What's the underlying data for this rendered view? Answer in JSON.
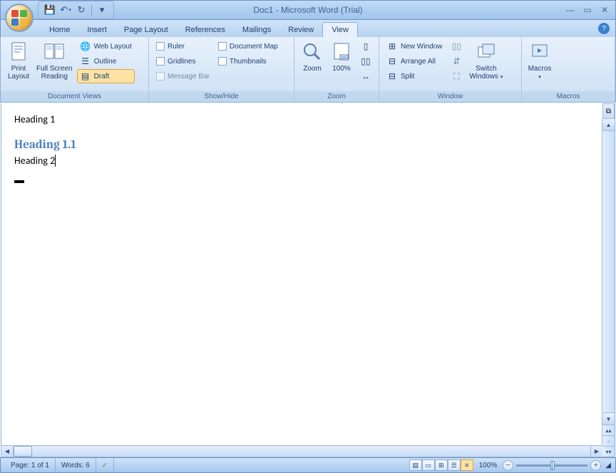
{
  "title": "Doc1 - Microsoft Word (Trial)",
  "qat": {
    "customize": "▾"
  },
  "tabs": {
    "home": "Home",
    "insert": "Insert",
    "page_layout": "Page Layout",
    "references": "References",
    "mailings": "Mailings",
    "review": "Review",
    "view": "View"
  },
  "ribbon": {
    "document_views": {
      "label": "Document Views",
      "print_layout": "Print\nLayout",
      "full_screen": "Full Screen\nReading",
      "web_layout": "Web Layout",
      "outline": "Outline",
      "draft": "Draft"
    },
    "show_hide": {
      "label": "Show/Hide",
      "ruler": "Ruler",
      "gridlines": "Gridlines",
      "message_bar": "Message Bar",
      "doc_map": "Document Map",
      "thumbnails": "Thumbnails"
    },
    "zoom": {
      "label": "Zoom",
      "zoom": "Zoom",
      "hundred": "100%"
    },
    "window": {
      "label": "Window",
      "new_window": "New Window",
      "arrange_all": "Arrange All",
      "split": "Split",
      "switch": "Switch\nWindows"
    },
    "macros": {
      "label": "Macros",
      "macros": "Macros"
    }
  },
  "document": {
    "line1": "Heading 1",
    "line2": "Heading 1.1",
    "line3": "Heading 2"
  },
  "status": {
    "page": "Page: 1 of 1",
    "words": "Words: 6",
    "zoom_pct": "100%"
  }
}
